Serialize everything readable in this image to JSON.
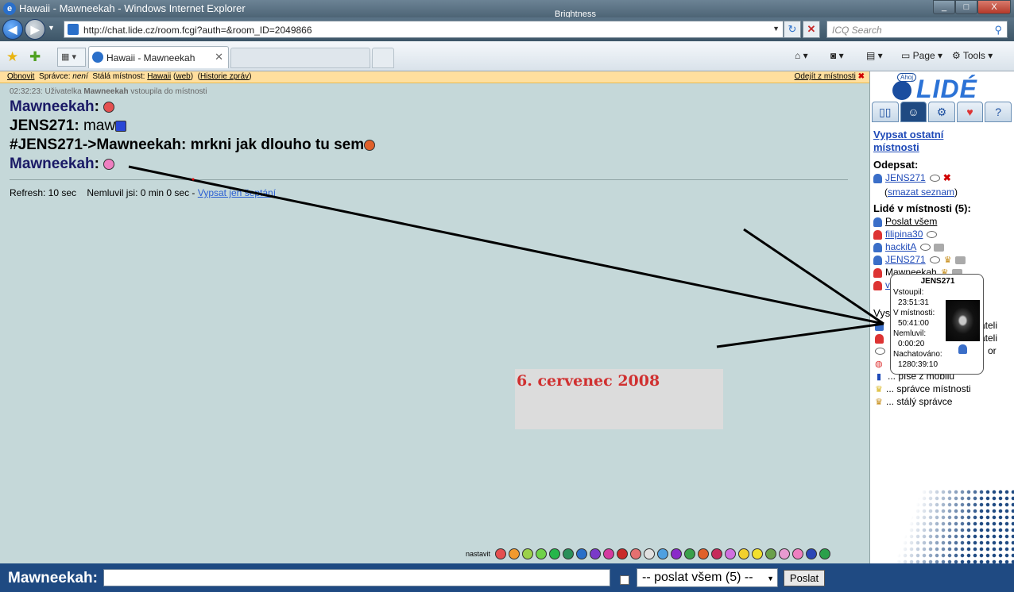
{
  "window": {
    "title": "Hawaii - Mawneekah - Windows Internet Explorer",
    "brightness_label": "Brightness",
    "min_glyph": "_",
    "max_glyph": "□",
    "close_glyph": "X"
  },
  "addressbar": {
    "url": "http://chat.lide.cz/room.fcgi?auth=&room_ID=2049866",
    "search_placeholder": "ICQ Search"
  },
  "tabs": {
    "active_label": "Hawaii - Mawneekah",
    "page_label": "Page",
    "tools_label": "Tools"
  },
  "infobar": {
    "refresh": "Obnovit",
    "admin_label": "Správce:",
    "admin_value": "není",
    "permanent_label": "Stálá místnost:",
    "permanent_room": "Hawaii",
    "web_link": "web",
    "history": "Historie zpráv",
    "leave": "Odejít z místnosti"
  },
  "chat": {
    "system_time": "02:32:23:",
    "system_prefix": "Uživatelka",
    "system_user": "Mawneekah",
    "system_suffix": "vstoupila do místnosti",
    "messages": [
      {
        "nick": "Mawneekah",
        "text": ""
      },
      {
        "nick": "JENS271",
        "text": "maw"
      },
      {
        "nick": "#JENS271->Mawneekah",
        "text": "mrkni jak dlouho tu sem"
      },
      {
        "nick": "Mawneekah",
        "text": ""
      }
    ],
    "refresh_text": "Refresh: 10 sec",
    "idle_text": "Nemluvil jsi: 0 min 0 sec -",
    "whisper_link": "Vypsat jen šeptání",
    "date_note": "6. cervenec 2008",
    "emoticons_label": "nastavit"
  },
  "bottombar": {
    "nick_label": "Mawneekah:",
    "message_value": "",
    "recipient": "-- poslat všem (5) --",
    "send_label": "Poslat"
  },
  "sidebar": {
    "logo_greeting": "Ahoj",
    "logo_text": "LIDÉ",
    "list_rooms": "Vypsat ostatní místnosti",
    "unsubscribe_heading": "Odepsat:",
    "unsubscribed_user": "JENS271",
    "clear_list": "smazat seznam",
    "people_heading": "Lidé v místnosti (5):",
    "send_all": "Poslat všem",
    "users": [
      {
        "name": "filipina30",
        "gender": "f"
      },
      {
        "name": "hackitA",
        "gender": "m"
      },
      {
        "name": "JENS271",
        "gender": "m"
      },
      {
        "name": "Mawneekah",
        "gender": "f"
      },
      {
        "name": "v",
        "gender": "f"
      }
    ],
    "legend_fragments": {
      "heading": "Vys",
      "row1": "ateli",
      "row2": "ateli",
      "row3": "or"
    },
    "legend": [
      "... píše z mobilu",
      "... správce místnosti",
      "... stálý správce"
    ]
  },
  "tooltip": {
    "name": "JENS271",
    "entered_label": "Vstoupil:",
    "entered_value": "23:51:31",
    "in_room_label": "V místnosti:",
    "in_room_value": "50:41:00",
    "idle_label": "Nemluvil:",
    "idle_value": "0:00:20",
    "chatted_label": "Nachatováno:",
    "chatted_value": "1280:39:10"
  }
}
